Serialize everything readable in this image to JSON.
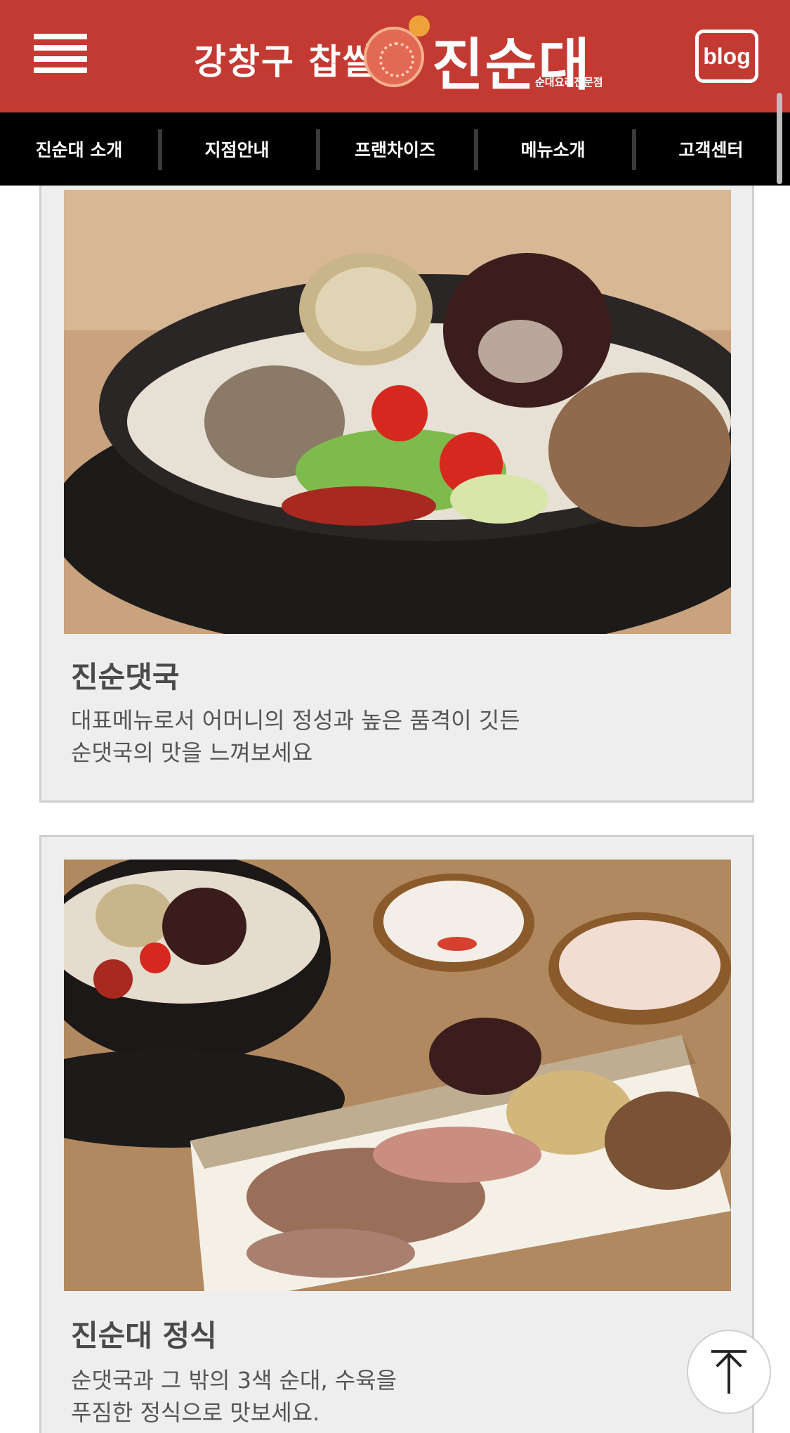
{
  "header": {
    "brand_left": "강창구 찹쌀",
    "brand_main": "진순대",
    "brand_sub": "순대요리전문점",
    "blog_label": "blog",
    "background_color": "#c33a32"
  },
  "nav": {
    "items": [
      {
        "label": "진순대 소개"
      },
      {
        "label": "지점안내"
      },
      {
        "label": "프랜차이즈"
      },
      {
        "label": "메뉴소개"
      },
      {
        "label": "고객센터"
      }
    ]
  },
  "menu": [
    {
      "title": "진순댓국",
      "description": "대표메뉴로서 어머니의 정성과 높은 품격이 깃든\n순댓국의 맛을 느껴보세요"
    },
    {
      "title": "진순대 정식",
      "description": "순댓국과 그 밖의 3색 순대, 수육을\n푸짐한 정식으로 맛보세요."
    }
  ],
  "icons": {
    "menu": "hamburger-menu-icon",
    "scroll_top": "arrow-up-icon"
  }
}
